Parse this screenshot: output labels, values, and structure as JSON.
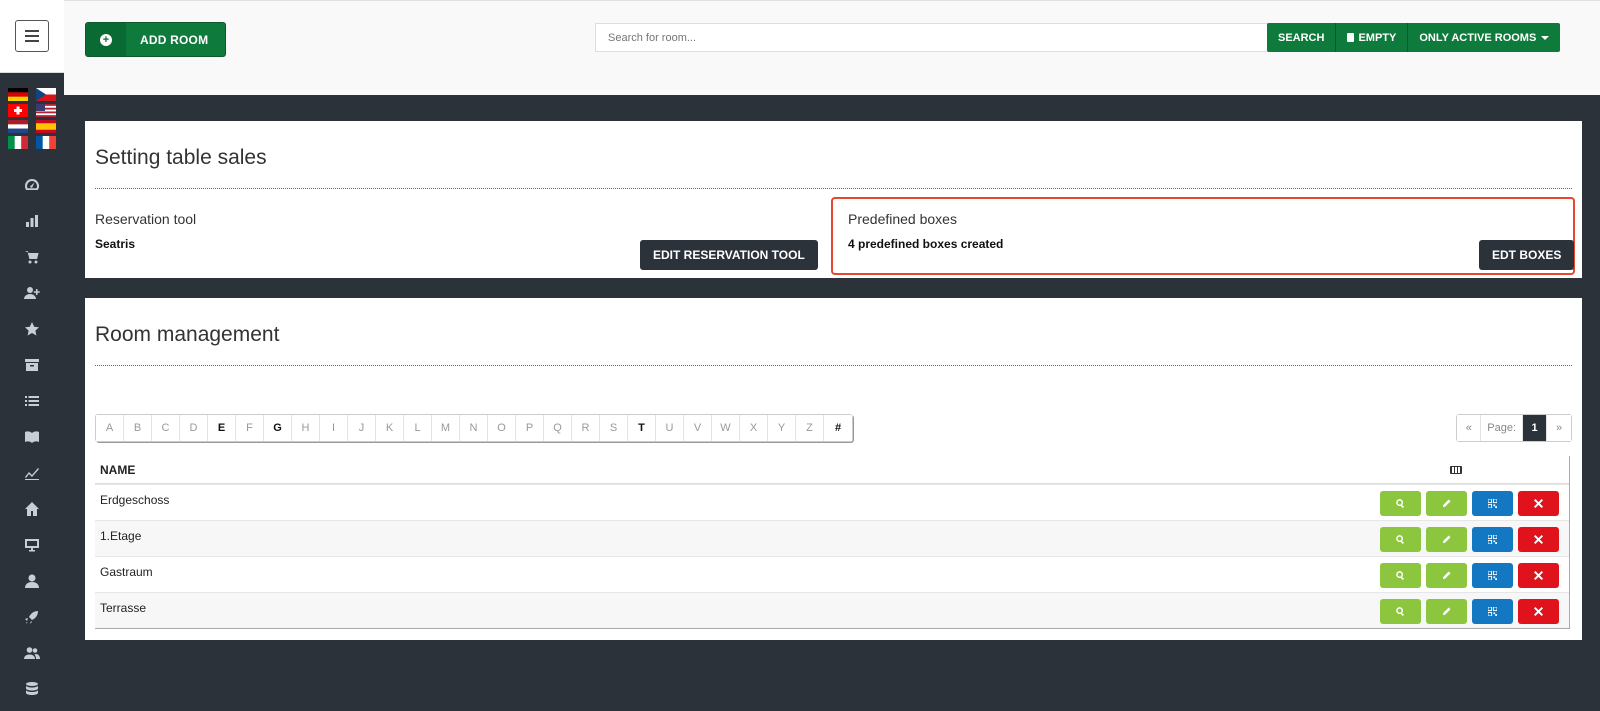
{
  "header": {
    "add_room_label": "ADD ROOM",
    "search_placeholder": "Search for room...",
    "search_label": "SEARCH",
    "empty_label": "EMPTY",
    "filter_label": "ONLY ACTIVE ROOMS"
  },
  "sidebar": {
    "flags": [
      "germany-flag",
      "czech-flag",
      "switzerland-flag",
      "usa-flag",
      "netherlands-flag",
      "spain-flag",
      "italy-flag",
      "france-flag"
    ],
    "icons": [
      "dashboard-icon",
      "bar-chart-icon",
      "cart-icon",
      "add-user-icon",
      "star-icon",
      "archive-icon",
      "list-icon",
      "book-icon",
      "line-chart-icon",
      "home-icon",
      "monitor-icon",
      "user-icon",
      "rocket-icon",
      "users-icon",
      "database-icon"
    ]
  },
  "table_sales": {
    "title": "Setting table sales",
    "reservation_label": "Reservation tool",
    "reservation_value": "Seatris",
    "edit_reservation_label": "EDIT RESERVATION TOOL",
    "boxes_label": "Predefined boxes",
    "boxes_value": "4 predefined boxes created",
    "edit_boxes_label": "EDT BOXES"
  },
  "room_management": {
    "title": "Room management",
    "alphabet": [
      "A",
      "B",
      "C",
      "D",
      "E",
      "F",
      "G",
      "H",
      "I",
      "J",
      "K",
      "L",
      "M",
      "N",
      "O",
      "P",
      "Q",
      "R",
      "S",
      "T",
      "U",
      "V",
      "W",
      "X",
      "Y",
      "Z",
      "#"
    ],
    "active_letters": [
      "E",
      "G",
      "T",
      "#"
    ],
    "pager": {
      "prev": "«",
      "page_label": "Page:",
      "current": "1",
      "next": "»"
    },
    "column_name": "NAME",
    "rows": [
      {
        "name": "Erdgeschoss"
      },
      {
        "name": "1.Etage"
      },
      {
        "name": "Gastraum"
      },
      {
        "name": "Terrasse"
      }
    ]
  },
  "colors": {
    "primary_green": "#0e7a3c",
    "dark": "#2b323a",
    "highlight": "#e8472f",
    "action_green": "#8cc63f",
    "action_blue": "#1377c2",
    "action_red": "#e0121b"
  }
}
